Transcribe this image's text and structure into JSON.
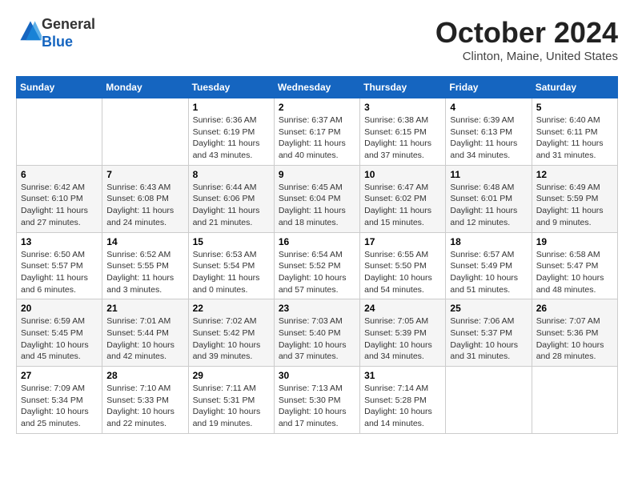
{
  "header": {
    "logo_general": "General",
    "logo_blue": "Blue",
    "month_title": "October 2024",
    "location": "Clinton, Maine, United States"
  },
  "weekdays": [
    "Sunday",
    "Monday",
    "Tuesday",
    "Wednesday",
    "Thursday",
    "Friday",
    "Saturday"
  ],
  "weeks": [
    [
      {
        "day": null
      },
      {
        "day": null
      },
      {
        "day": "1",
        "sunrise": "Sunrise: 6:36 AM",
        "sunset": "Sunset: 6:19 PM",
        "daylight": "Daylight: 11 hours and 43 minutes."
      },
      {
        "day": "2",
        "sunrise": "Sunrise: 6:37 AM",
        "sunset": "Sunset: 6:17 PM",
        "daylight": "Daylight: 11 hours and 40 minutes."
      },
      {
        "day": "3",
        "sunrise": "Sunrise: 6:38 AM",
        "sunset": "Sunset: 6:15 PM",
        "daylight": "Daylight: 11 hours and 37 minutes."
      },
      {
        "day": "4",
        "sunrise": "Sunrise: 6:39 AM",
        "sunset": "Sunset: 6:13 PM",
        "daylight": "Daylight: 11 hours and 34 minutes."
      },
      {
        "day": "5",
        "sunrise": "Sunrise: 6:40 AM",
        "sunset": "Sunset: 6:11 PM",
        "daylight": "Daylight: 11 hours and 31 minutes."
      }
    ],
    [
      {
        "day": "6",
        "sunrise": "Sunrise: 6:42 AM",
        "sunset": "Sunset: 6:10 PM",
        "daylight": "Daylight: 11 hours and 27 minutes."
      },
      {
        "day": "7",
        "sunrise": "Sunrise: 6:43 AM",
        "sunset": "Sunset: 6:08 PM",
        "daylight": "Daylight: 11 hours and 24 minutes."
      },
      {
        "day": "8",
        "sunrise": "Sunrise: 6:44 AM",
        "sunset": "Sunset: 6:06 PM",
        "daylight": "Daylight: 11 hours and 21 minutes."
      },
      {
        "day": "9",
        "sunrise": "Sunrise: 6:45 AM",
        "sunset": "Sunset: 6:04 PM",
        "daylight": "Daylight: 11 hours and 18 minutes."
      },
      {
        "day": "10",
        "sunrise": "Sunrise: 6:47 AM",
        "sunset": "Sunset: 6:02 PM",
        "daylight": "Daylight: 11 hours and 15 minutes."
      },
      {
        "day": "11",
        "sunrise": "Sunrise: 6:48 AM",
        "sunset": "Sunset: 6:01 PM",
        "daylight": "Daylight: 11 hours and 12 minutes."
      },
      {
        "day": "12",
        "sunrise": "Sunrise: 6:49 AM",
        "sunset": "Sunset: 5:59 PM",
        "daylight": "Daylight: 11 hours and 9 minutes."
      }
    ],
    [
      {
        "day": "13",
        "sunrise": "Sunrise: 6:50 AM",
        "sunset": "Sunset: 5:57 PM",
        "daylight": "Daylight: 11 hours and 6 minutes."
      },
      {
        "day": "14",
        "sunrise": "Sunrise: 6:52 AM",
        "sunset": "Sunset: 5:55 PM",
        "daylight": "Daylight: 11 hours and 3 minutes."
      },
      {
        "day": "15",
        "sunrise": "Sunrise: 6:53 AM",
        "sunset": "Sunset: 5:54 PM",
        "daylight": "Daylight: 11 hours and 0 minutes."
      },
      {
        "day": "16",
        "sunrise": "Sunrise: 6:54 AM",
        "sunset": "Sunset: 5:52 PM",
        "daylight": "Daylight: 10 hours and 57 minutes."
      },
      {
        "day": "17",
        "sunrise": "Sunrise: 6:55 AM",
        "sunset": "Sunset: 5:50 PM",
        "daylight": "Daylight: 10 hours and 54 minutes."
      },
      {
        "day": "18",
        "sunrise": "Sunrise: 6:57 AM",
        "sunset": "Sunset: 5:49 PM",
        "daylight": "Daylight: 10 hours and 51 minutes."
      },
      {
        "day": "19",
        "sunrise": "Sunrise: 6:58 AM",
        "sunset": "Sunset: 5:47 PM",
        "daylight": "Daylight: 10 hours and 48 minutes."
      }
    ],
    [
      {
        "day": "20",
        "sunrise": "Sunrise: 6:59 AM",
        "sunset": "Sunset: 5:45 PM",
        "daylight": "Daylight: 10 hours and 45 minutes."
      },
      {
        "day": "21",
        "sunrise": "Sunrise: 7:01 AM",
        "sunset": "Sunset: 5:44 PM",
        "daylight": "Daylight: 10 hours and 42 minutes."
      },
      {
        "day": "22",
        "sunrise": "Sunrise: 7:02 AM",
        "sunset": "Sunset: 5:42 PM",
        "daylight": "Daylight: 10 hours and 39 minutes."
      },
      {
        "day": "23",
        "sunrise": "Sunrise: 7:03 AM",
        "sunset": "Sunset: 5:40 PM",
        "daylight": "Daylight: 10 hours and 37 minutes."
      },
      {
        "day": "24",
        "sunrise": "Sunrise: 7:05 AM",
        "sunset": "Sunset: 5:39 PM",
        "daylight": "Daylight: 10 hours and 34 minutes."
      },
      {
        "day": "25",
        "sunrise": "Sunrise: 7:06 AM",
        "sunset": "Sunset: 5:37 PM",
        "daylight": "Daylight: 10 hours and 31 minutes."
      },
      {
        "day": "26",
        "sunrise": "Sunrise: 7:07 AM",
        "sunset": "Sunset: 5:36 PM",
        "daylight": "Daylight: 10 hours and 28 minutes."
      }
    ],
    [
      {
        "day": "27",
        "sunrise": "Sunrise: 7:09 AM",
        "sunset": "Sunset: 5:34 PM",
        "daylight": "Daylight: 10 hours and 25 minutes."
      },
      {
        "day": "28",
        "sunrise": "Sunrise: 7:10 AM",
        "sunset": "Sunset: 5:33 PM",
        "daylight": "Daylight: 10 hours and 22 minutes."
      },
      {
        "day": "29",
        "sunrise": "Sunrise: 7:11 AM",
        "sunset": "Sunset: 5:31 PM",
        "daylight": "Daylight: 10 hours and 19 minutes."
      },
      {
        "day": "30",
        "sunrise": "Sunrise: 7:13 AM",
        "sunset": "Sunset: 5:30 PM",
        "daylight": "Daylight: 10 hours and 17 minutes."
      },
      {
        "day": "31",
        "sunrise": "Sunrise: 7:14 AM",
        "sunset": "Sunset: 5:28 PM",
        "daylight": "Daylight: 10 hours and 14 minutes."
      },
      {
        "day": null
      },
      {
        "day": null
      }
    ]
  ]
}
